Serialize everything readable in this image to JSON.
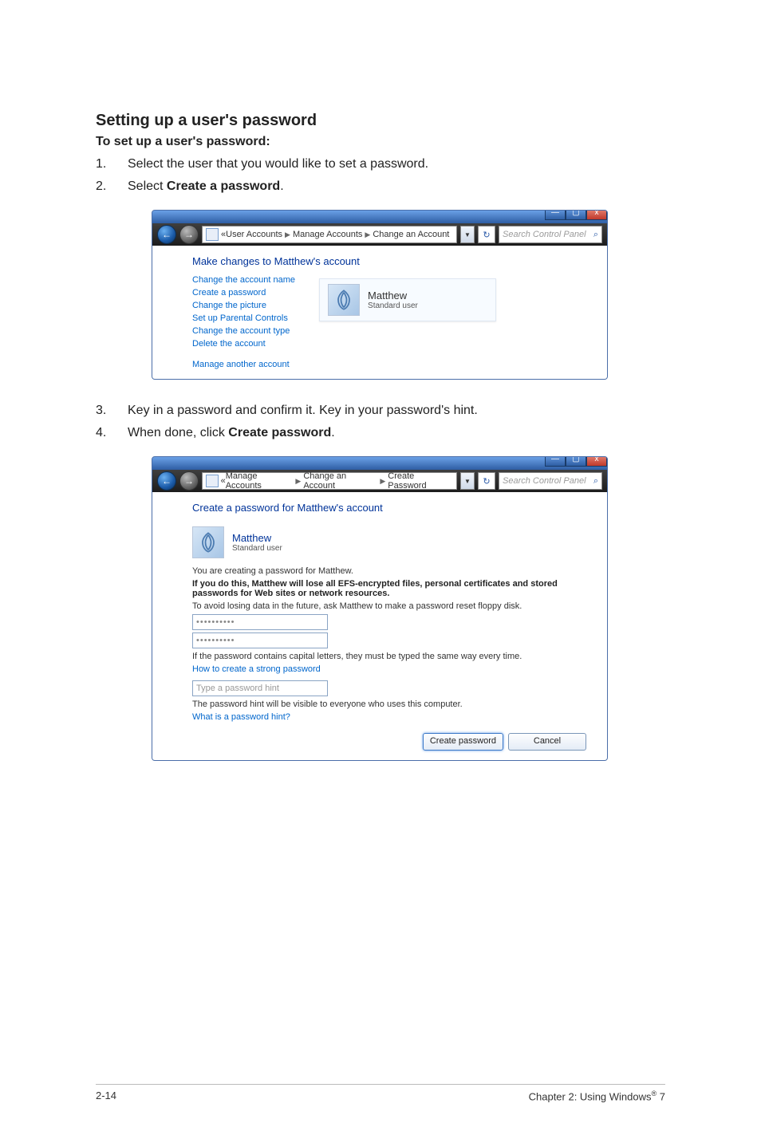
{
  "section": {
    "title": "Setting up a user's password",
    "subheading": "To set up a user's password:"
  },
  "steps_a": [
    {
      "num": "1.",
      "text": "Select the user that you would like to set a password."
    },
    {
      "num": "2.",
      "text_prefix": "Select ",
      "bold": "Create a password",
      "text_suffix": "."
    }
  ],
  "steps_b": [
    {
      "num": "3.",
      "text": "Key in a password and confirm it. Key in your password's hint."
    },
    {
      "num": "4.",
      "text_prefix": "When done, click ",
      "bold": "Create password",
      "text_suffix": "."
    }
  ],
  "win1": {
    "title_buttons": {
      "min": "—",
      "max": "▢",
      "close": "x"
    },
    "nav": {
      "back_glyph": "←",
      "fwd_glyph": "→",
      "breadcrumb_prefix": "«",
      "crumbs": [
        "User Accounts",
        "Manage Accounts",
        "Change an Account"
      ],
      "refresh": "↻",
      "search_placeholder": "Search Control Panel",
      "mag": "⌕"
    },
    "heading": "Make changes to Matthew's account",
    "links": [
      "Change the account name",
      "Create a password",
      "Change the picture",
      "Set up Parental Controls",
      "Change the account type",
      "Delete the account"
    ],
    "manage_link": "Manage another account",
    "user": {
      "name": "Matthew",
      "type": "Standard user"
    }
  },
  "win2": {
    "title_buttons": {
      "min": "—",
      "max": "▢",
      "close": "x"
    },
    "nav": {
      "back_glyph": "←",
      "fwd_glyph": "→",
      "breadcrumb_prefix": "«",
      "crumbs": [
        "Manage Accounts",
        "Change an Account",
        "Create Password"
      ],
      "refresh": "↻",
      "search_placeholder": "Search Control Panel",
      "mag": "⌕"
    },
    "heading": "Create a password for Matthew's account",
    "user": {
      "name": "Matthew",
      "type": "Standard user"
    },
    "line1": "You are creating a password for Matthew.",
    "warn_bold": "If you do this, Matthew will lose all EFS-encrypted files, personal certificates and stored passwords for Web sites or network resources.",
    "line2": "To avoid losing data in the future, ask Matthew to make a password reset floppy disk.",
    "pw1": "••••••••••",
    "pw2": "••••••••••",
    "caps_note": "If the password contains capital letters, they must be typed the same way every time.",
    "strong_link": "How to create a strong password",
    "hint_placeholder": "Type a password hint",
    "hint_note": "The password hint will be visible to everyone who uses this computer.",
    "hint_link": "What is a password hint?",
    "buttons": {
      "create": "Create password",
      "cancel": "Cancel"
    }
  },
  "footer": {
    "left": "2-14",
    "right_prefix": "Chapter 2: Using Windows",
    "right_sup": "®",
    "right_suffix": " 7"
  }
}
